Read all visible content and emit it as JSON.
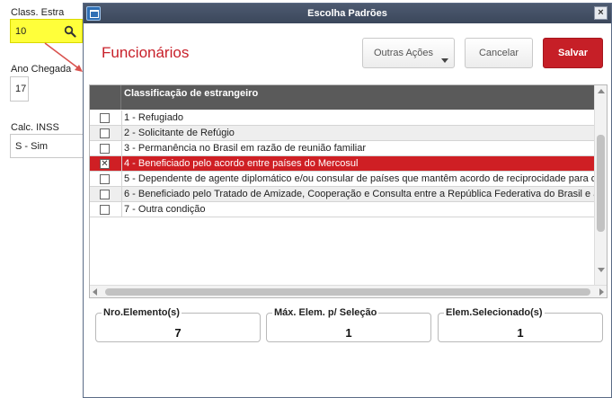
{
  "background_form": {
    "class_estra_label": "Class. Estra",
    "class_estra_value": "10",
    "ano_chegada_label": "Ano Chegada",
    "ano_chegada_value": "17",
    "calc_inss_label": "Calc. INSS",
    "calc_inss_value": "S - Sim"
  },
  "dialog": {
    "title": "Escolha Padrões",
    "close_label": "×",
    "page_title": "Funcionários",
    "buttons": {
      "more_label": "Outras Ações",
      "cancel_label": "Cancelar",
      "save_label": "Salvar"
    },
    "grid": {
      "column_header": "Classificação de estrangeiro",
      "rows": [
        {
          "label": "1 - Refugiado",
          "checked": false,
          "selected": false
        },
        {
          "label": "2 - Solicitante de Refúgio",
          "checked": false,
          "selected": false
        },
        {
          "label": "3 - Permanência no Brasil em razão de reunião familiar",
          "checked": false,
          "selected": false
        },
        {
          "label": "4 - Beneficiado pelo acordo entre países do Mercosul",
          "checked": true,
          "selected": true
        },
        {
          "label": "5 - Dependente de agente diplomático e/ou consular de países que mantêm acordo de reciprocidade para o",
          "checked": false,
          "selected": false
        },
        {
          "label": "6 - Beneficiado pelo Tratado de Amizade, Cooperação e Consulta entre a República Federativa do Brasil e a",
          "checked": false,
          "selected": false
        },
        {
          "label": "7 - Outra condição",
          "checked": false,
          "selected": false
        }
      ]
    },
    "summary": {
      "nro_elementos_label": "Nro.Elemento(s)",
      "nro_elementos_value": "7",
      "max_elem_label": "Máx. Elem. p/ Seleção",
      "max_elem_value": "1",
      "elem_selecionado_label": "Elem.Selecionado(s)",
      "elem_selecionado_value": "1"
    }
  },
  "colors": {
    "accent_red": "#c61f27",
    "titlebar": "#444f63",
    "highlight_yellow": "#ffff3a",
    "grid_header": "#5a5a5a"
  },
  "icons": {
    "lookup": "magnifier-icon",
    "app": "window-icon",
    "close": "close-icon",
    "dropdown": "caret-down-icon"
  }
}
